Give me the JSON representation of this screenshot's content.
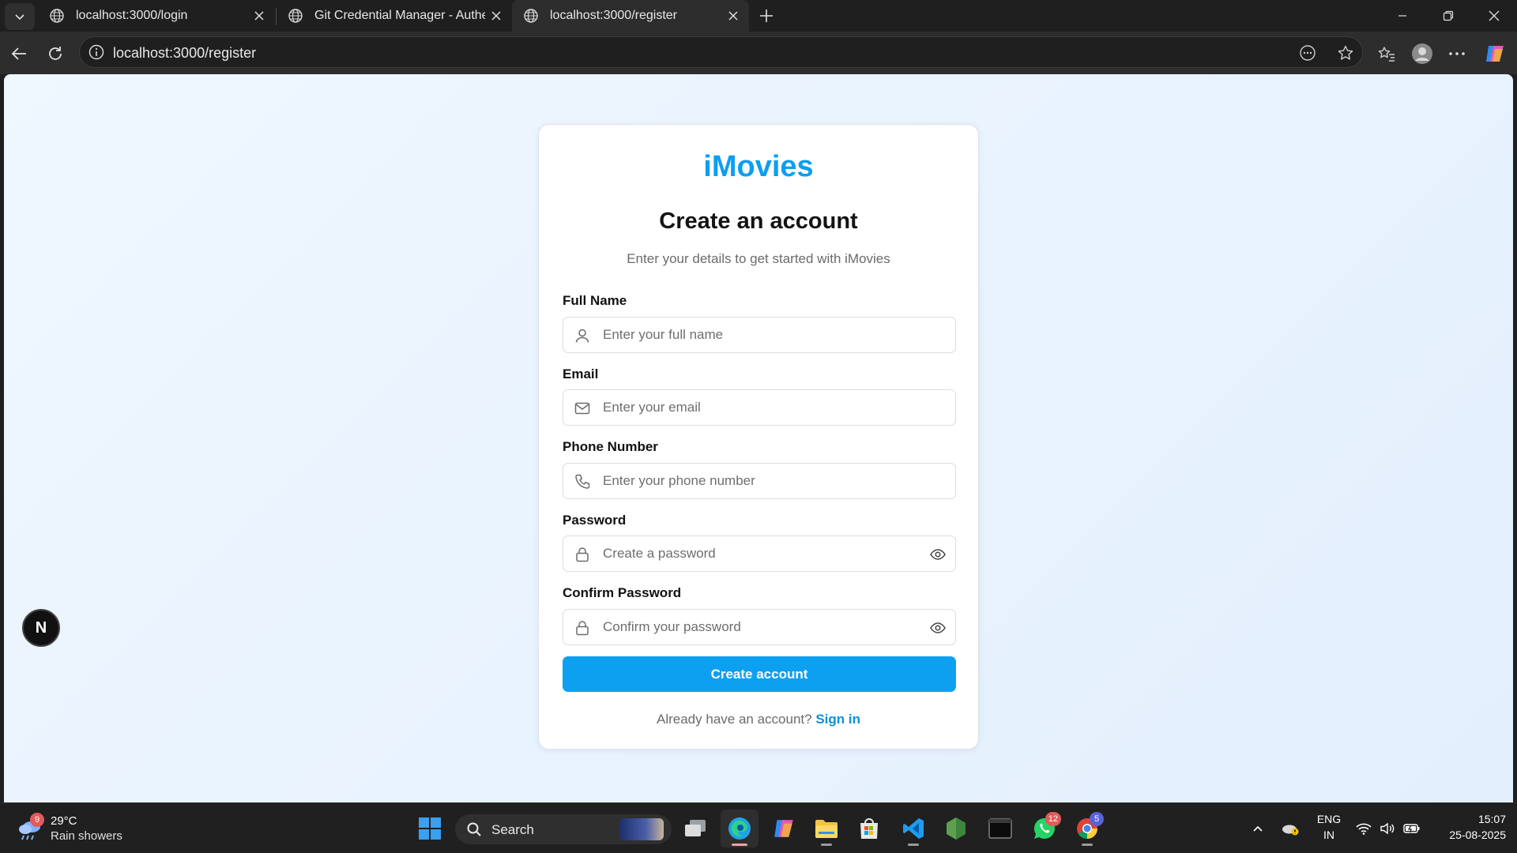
{
  "browser": {
    "tabs": [
      {
        "title": "localhost:3000/login",
        "active": false
      },
      {
        "title": "Git Credential Manager - Authent",
        "active": false
      },
      {
        "title": "localhost:3000/register",
        "active": true
      }
    ],
    "address": "localhost:3000/register"
  },
  "page": {
    "brand": "iMovies",
    "heading": "Create an account",
    "subheading": "Enter your details to get started with iMovies",
    "fields": [
      {
        "label": "Full Name",
        "placeholder": "Enter your full name",
        "icon": "user-icon"
      },
      {
        "label": "Email",
        "placeholder": "Enter your email",
        "icon": "mail-icon"
      },
      {
        "label": "Phone Number",
        "placeholder": "Enter your phone number",
        "icon": "phone-icon"
      },
      {
        "label": "Password",
        "placeholder": "Create a password",
        "icon": "lock-icon",
        "toggle": "eye-icon"
      },
      {
        "label": "Confirm Password",
        "placeholder": "Confirm your password",
        "icon": "lock-icon",
        "toggle": "eye-icon"
      }
    ],
    "submit_label": "Create account",
    "footer_text": "Already have an account?",
    "footer_link": "Sign in",
    "dev_badge": "N"
  },
  "taskbar": {
    "weather": {
      "badge": "9",
      "temp": "29°C",
      "condition": "Rain showers"
    },
    "search_label": "Search",
    "badges": {
      "whatsapp": "12",
      "chrome": "5"
    },
    "language": {
      "line1": "ENG",
      "line2": "IN"
    },
    "clock": {
      "time": "15:07",
      "date": "25-08-2025"
    }
  },
  "colors": {
    "accent": "#0ea0f0",
    "brand": "#0e9ef0",
    "link": "#0e8fd9",
    "page_bg": "#eaf4ff"
  }
}
